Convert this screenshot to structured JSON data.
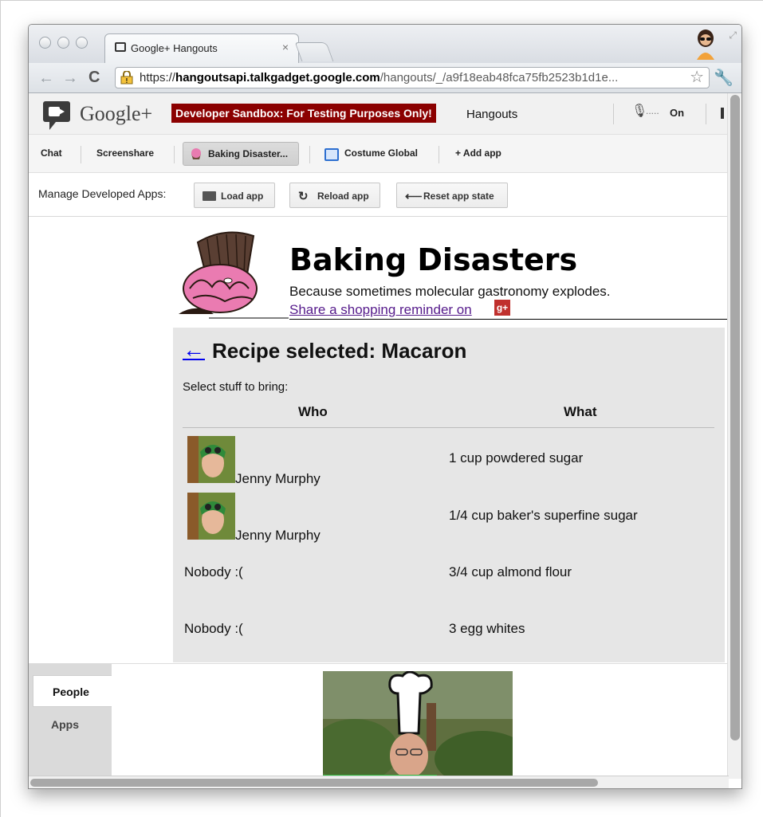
{
  "browser": {
    "tab_title": "Google+ Hangouts",
    "tab_close": "×",
    "url_scheme": "https://",
    "url_host": "hangoutsapi.talkgadget.google.com",
    "url_path": "/hangouts/_/a9f18eab48fca75fb2523b1d1e...",
    "star": "☆",
    "wrench": "🔧",
    "back": "←",
    "forward": "→",
    "reload": "C"
  },
  "gbar": {
    "logo_text": "Google+",
    "sandbox_label": "Developer Sandbox: For Testing Purposes Only!",
    "title": "Hangouts",
    "mic_icon": "🎙",
    "mic_level": ".....",
    "mic_status": "On"
  },
  "appbar": {
    "items": {
      "chat": "Chat",
      "screenshare": "Screenshare",
      "baking": "Baking Disaster...",
      "costume": "Costume Global",
      "add_app": "+ Add app"
    }
  },
  "manage": {
    "label": "Manage Developed Apps:",
    "load": "Load app",
    "reload": "Reload app",
    "reset": "Reset app state",
    "reload_icon": "↻",
    "reset_icon": "⟵"
  },
  "app": {
    "title": "Baking Disasters",
    "tagline": "Because sometimes molecular gastronomy explodes.",
    "share": "Share a shopping reminder on",
    "gplus_glyph": "g+",
    "back_arrow": "←",
    "recipe_title": "Recipe selected: Macaron",
    "select_label": "Select stuff to bring:",
    "col_who": "Who",
    "col_what": "What",
    "rows": [
      {
        "who": "Jenny Murphy",
        "what": "1 cup powdered sugar"
      },
      {
        "who": "Jenny Murphy",
        "what": "1/4 cup baker's superfine sugar"
      },
      {
        "who": "Nobody :(",
        "what": "3/4 cup almond flour"
      },
      {
        "who": "Nobody :(",
        "what": "3 egg whites"
      }
    ]
  },
  "sidebar": {
    "people": "People",
    "apps": "Apps"
  },
  "colors": {
    "sandbox_bg": "#8b0000",
    "panel_bg": "#e6e6e6",
    "link": "#551a8b"
  }
}
